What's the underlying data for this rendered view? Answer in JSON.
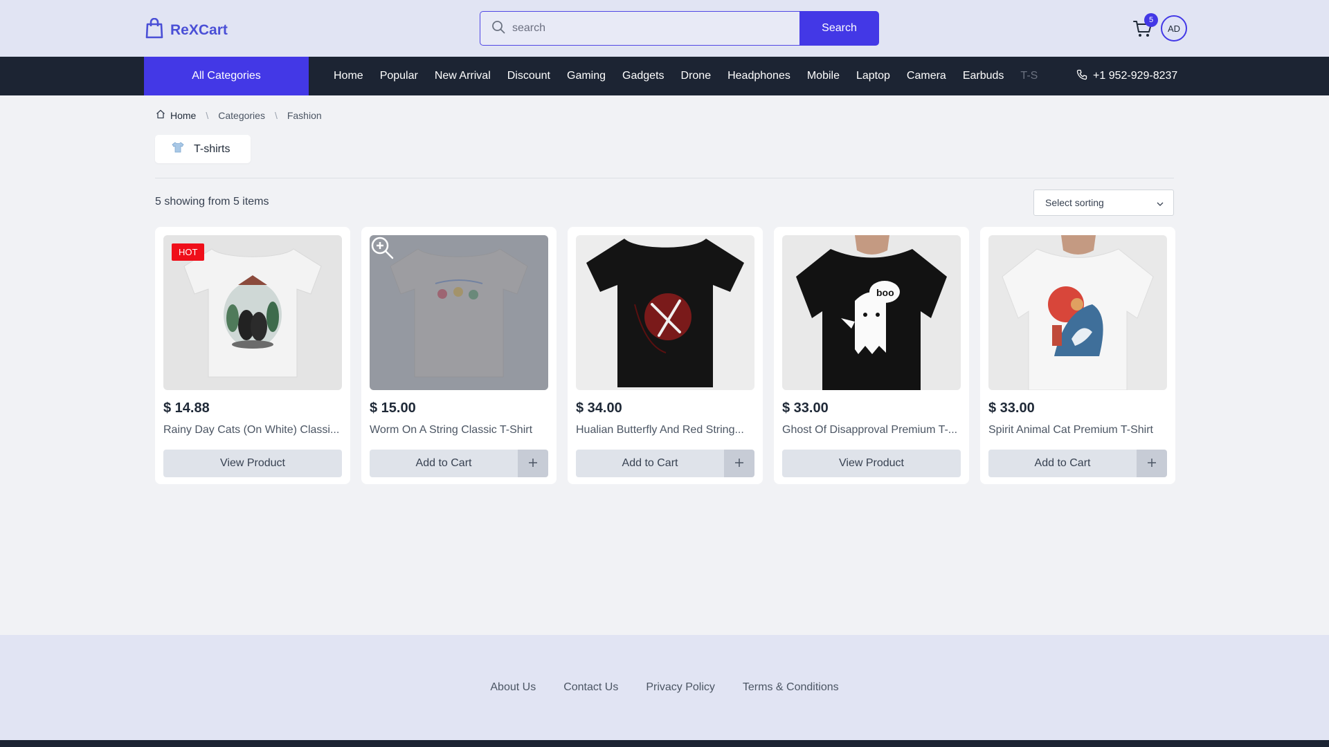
{
  "header": {
    "brand": "ReXCart",
    "search_placeholder": "search",
    "search_button": "Search",
    "cart_count": "5",
    "avatar_initials": "AD"
  },
  "nav": {
    "all_categories": "All Categories",
    "items": [
      "Home",
      "Popular",
      "New Arrival",
      "Discount",
      "Gaming",
      "Gadgets",
      "Drone",
      "Headphones",
      "Mobile",
      "Laptop",
      "Camera",
      "Earbuds",
      "T-S"
    ],
    "phone": "+1 952-929-8237"
  },
  "breadcrumb": [
    "Home",
    "Categories",
    "Fashion"
  ],
  "category_chip": "T-shirts",
  "results_count": "5 showing from 5 items",
  "sort_label": "Select sorting",
  "products": [
    {
      "price": "$ 14.88",
      "title": "Rainy Day Cats (On White) Classi...",
      "badge": "HOT",
      "button": "View Product"
    },
    {
      "price": "$ 15.00",
      "title": "Worm On A String Classic T-Shirt",
      "button": "Add to Cart"
    },
    {
      "price": "$ 34.00",
      "title": "Hualian Butterfly And Red String...",
      "button": "Add to Cart"
    },
    {
      "price": "$ 33.00",
      "title": "Ghost Of Disapproval Premium T-...",
      "button": "View Product",
      "print_text": "boo"
    },
    {
      "price": "$ 33.00",
      "title": "Spirit Animal Cat Premium T-Shirt",
      "button": "Add to Cart"
    }
  ],
  "footer": {
    "links": [
      "About Us",
      "Contact Us",
      "Privacy Policy",
      "Terms & Conditions"
    ]
  },
  "colors": {
    "accent": "#4338e6",
    "nav_bg": "#1c2433",
    "header_bg": "#e1e4f3",
    "hot_badge": "#ef0f1a"
  }
}
